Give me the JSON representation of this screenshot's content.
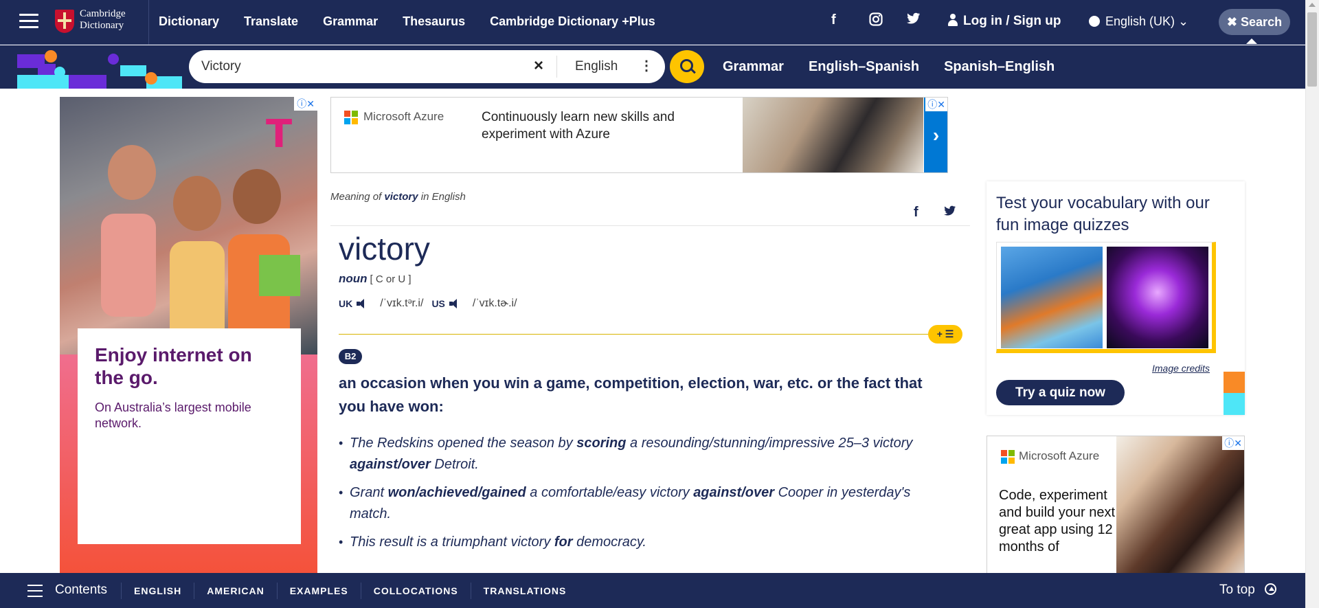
{
  "header": {
    "logo_line1": "Cambridge",
    "logo_line2": "Dictionary",
    "nav": [
      "Dictionary",
      "Translate",
      "Grammar",
      "Thesaurus",
      "Cambridge Dictionary +Plus"
    ],
    "social_icons": [
      "facebook-icon",
      "instagram-icon",
      "twitter-icon"
    ],
    "login_label": "Log in / Sign up",
    "language_label": "English (UK)",
    "search_label": "Search"
  },
  "search": {
    "value": "Victory",
    "dictionary": "English",
    "subnav": [
      "Grammar",
      "English–Spanish",
      "Spanish–English"
    ]
  },
  "ads": {
    "left_headline": "Enjoy internet on the go.",
    "left_sub": "On Australia’s largest mobile network.",
    "left_brand_mark": "T",
    "top_brand": "Microsoft Azure",
    "top_text": "Continuously learn new skills and experiment with Azure",
    "top_arrow": "›",
    "right_brand": "Microsoft Azure",
    "right_text": "Code, experiment and build your next great app using 12 months of"
  },
  "entry": {
    "meaning_prefix": "Meaning of ",
    "meaning_word": "victory",
    "meaning_suffix": " in English",
    "headword": "victory",
    "pos": "noun",
    "grammar": "[ C or U ]",
    "uk_label": "UK",
    "uk_ipa": "/ˈvɪk.tᵊr.i/",
    "us_label": "US",
    "us_ipa": "/ˈvɪk.tɚ.i/",
    "level": "B2",
    "definition": "an occasion when you win a game, competition, election, war, etc. or the fact that you have won:",
    "examples": [
      [
        "The Redskins opened the season by ",
        "scoring",
        " a resounding/stunning/impressive 25–3 victory ",
        "against/over",
        " Detroit."
      ],
      [
        "Grant ",
        "won/achieved/gained",
        " a comfortable/easy victory ",
        "against/over",
        " Cooper in yesterday's match."
      ],
      [
        "This result is a triumphant victory ",
        "for",
        " democracy."
      ]
    ]
  },
  "quiz": {
    "title": "Test your vocabulary with our fun image quizzes",
    "image_credits": "Image credits",
    "button": "Try a quiz now"
  },
  "bottombar": {
    "contents": "Contents",
    "links": [
      "ENGLISH",
      "AMERICAN",
      "EXAMPLES",
      "COLLOCATIONS",
      "TRANSLATIONS"
    ],
    "to_top": "To top"
  },
  "colors": {
    "navy": "#1d2a57",
    "yellow": "#fec400",
    "orange": "#f98a26",
    "cyan": "#4ee6f7",
    "purple": "#6a2cd8"
  }
}
